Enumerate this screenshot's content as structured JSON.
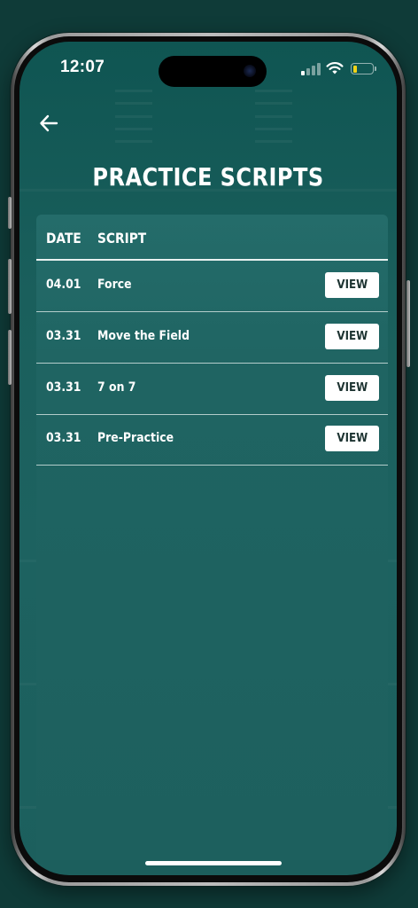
{
  "status_bar": {
    "time": "12:07",
    "signal_bars_active": 1,
    "signal_bars_total": 4,
    "battery_level": 0.1,
    "battery_color": "#f2d417"
  },
  "header": {
    "back_icon": "arrow-left-icon",
    "title": "PRACTICE SCRIPTS"
  },
  "table": {
    "columns": [
      "DATE",
      "SCRIPT"
    ],
    "rows": [
      {
        "date": "04.01",
        "script": "Force",
        "action": "VIEW"
      },
      {
        "date": "03.31",
        "script": "Move the Field",
        "action": "VIEW"
      },
      {
        "date": "03.31",
        "script": "7 on 7",
        "action": "VIEW"
      },
      {
        "date": "03.31",
        "script": "Pre-Practice",
        "action": "VIEW"
      }
    ]
  },
  "colors": {
    "background": "#0f3b38",
    "screen": "#1d6260",
    "panel": "#246c6a",
    "button_bg": "#ffffff",
    "button_text": "#1d3331"
  }
}
